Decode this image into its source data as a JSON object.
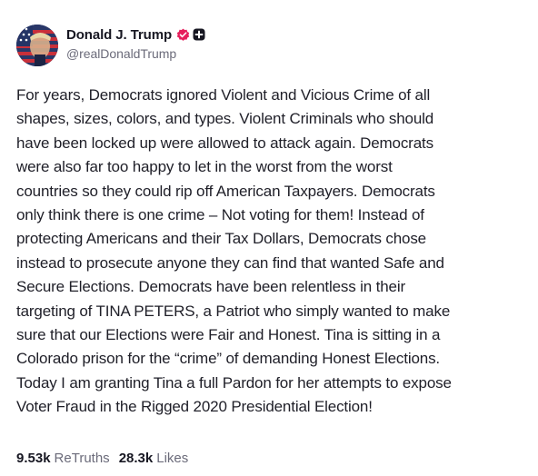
{
  "author": {
    "display_name": "Donald J. Trump",
    "handle": "@realDonaldTrump",
    "verified_icon": "verified-badge-icon",
    "plus_icon": "plus-icon",
    "verified_color": "#e61f5c"
  },
  "post": {
    "text": "For years, Democrats ignored Violent and Vicious Crime of all\nshapes, sizes, colors, and types. Violent Criminals who should\nhave been locked up were allowed to attack again. Democrats\nwere also far too happy to let in the worst from the worst\ncountries so they could rip off American Taxpayers. Democrats\nonly think there is one crime – Not voting for them! Instead of\nprotecting Americans and their Tax Dollars, Democrats chose\ninstead to prosecute anyone they can find that wanted Safe and\nSecure Elections. Democrats have been relentless in their\ntargeting of TINA PETERS, a Patriot who simply wanted to make\nsure that our Elections were Fair and Honest. Tina is sitting in a\nColorado prison for the “crime” of demanding Honest Elections.\nToday I am granting Tina a full Pardon for her attempts to expose\nVoter Fraud in the Rigged 2020 Presidential Election!"
  },
  "stats": {
    "retruths_count": "9.53k",
    "retruths_label": "ReTruths",
    "likes_count": "28.3k",
    "likes_label": "Likes"
  }
}
